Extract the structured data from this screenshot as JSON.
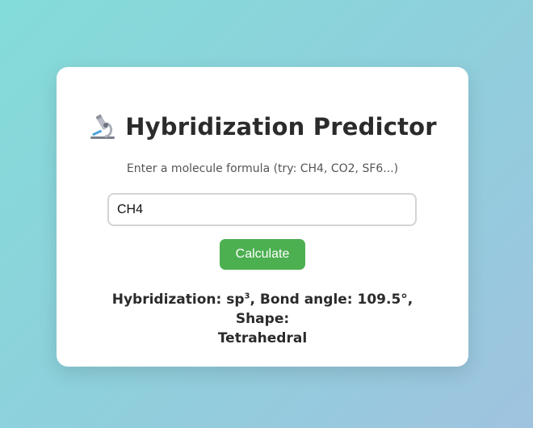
{
  "header": {
    "icon": "microscope-icon",
    "title": "Hybridization Predictor"
  },
  "form": {
    "instruction": "Enter a molecule formula (try: CH4, CO2, SF6...)",
    "input_value": "CH4",
    "button_label": "Calculate"
  },
  "result": {
    "hybridization_label": "Hybridization: ",
    "hybridization_base": "sp",
    "hybridization_exponent": "3",
    "bond_angle_text": ", Bond angle: 109.5°, Shape:",
    "shape_value": "Tetrahedral"
  },
  "colors": {
    "button_bg": "#4caf50",
    "card_bg": "#ffffff",
    "title_text": "#2b2b2b"
  }
}
